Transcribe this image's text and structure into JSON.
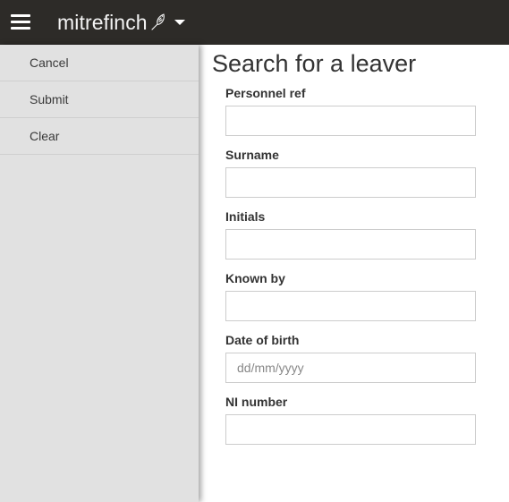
{
  "header": {
    "brand": "mitrefinch"
  },
  "sidebar": {
    "items": [
      {
        "label": "Cancel"
      },
      {
        "label": "Submit"
      },
      {
        "label": "Clear"
      }
    ]
  },
  "main": {
    "title": "Search for a leaver",
    "fields": [
      {
        "label": "Personnel ref",
        "value": "",
        "placeholder": ""
      },
      {
        "label": "Surname",
        "value": "",
        "placeholder": ""
      },
      {
        "label": "Initials",
        "value": "",
        "placeholder": ""
      },
      {
        "label": "Known by",
        "value": "",
        "placeholder": ""
      },
      {
        "label": "Date of birth",
        "value": "",
        "placeholder": "dd/mm/yyyy"
      },
      {
        "label": "NI number",
        "value": "",
        "placeholder": ""
      }
    ]
  },
  "colors": {
    "topbar": "#2d2b28",
    "sidebar": "#e1e1e1"
  },
  "icons": [
    "hamburger-menu-icon",
    "bird-logo-icon",
    "caret-down-icon"
  ]
}
